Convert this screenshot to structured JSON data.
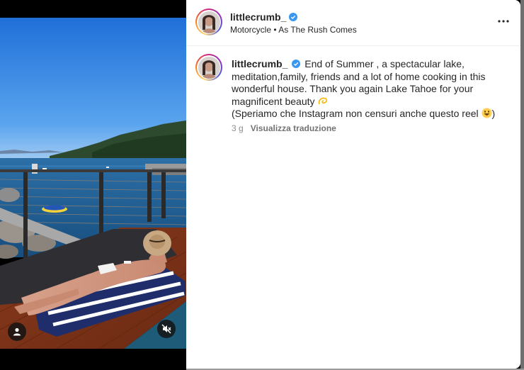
{
  "post": {
    "username": "littlecrumb_",
    "audio": "Motorcycle • As The Rush Comes"
  },
  "caption": {
    "username": "littlecrumb_",
    "line1": "End of Summer , a spectacular lake,",
    "line2": "meditation,family, friends and a lot of home cooking in this",
    "line3": "wonderful house. Thank you again Lake Tahoe for your",
    "line4": "magnificent beauty",
    "line5": "(Speriamo che Instagram non censuri anche questo reel",
    "line5_end": ")",
    "time": "3 g",
    "translate": "Visualizza traduzione"
  },
  "icons": {
    "verified": "verified-badge-icon",
    "more": "more-options-icon",
    "user": "user-icon",
    "mute": "muted-speaker-icon",
    "dizzy": "dizzy-emoji",
    "grin": "grinning-emoji"
  },
  "colors": {
    "verified": "#3897f0",
    "text": "#262626",
    "muted": "#8e8e8e"
  }
}
